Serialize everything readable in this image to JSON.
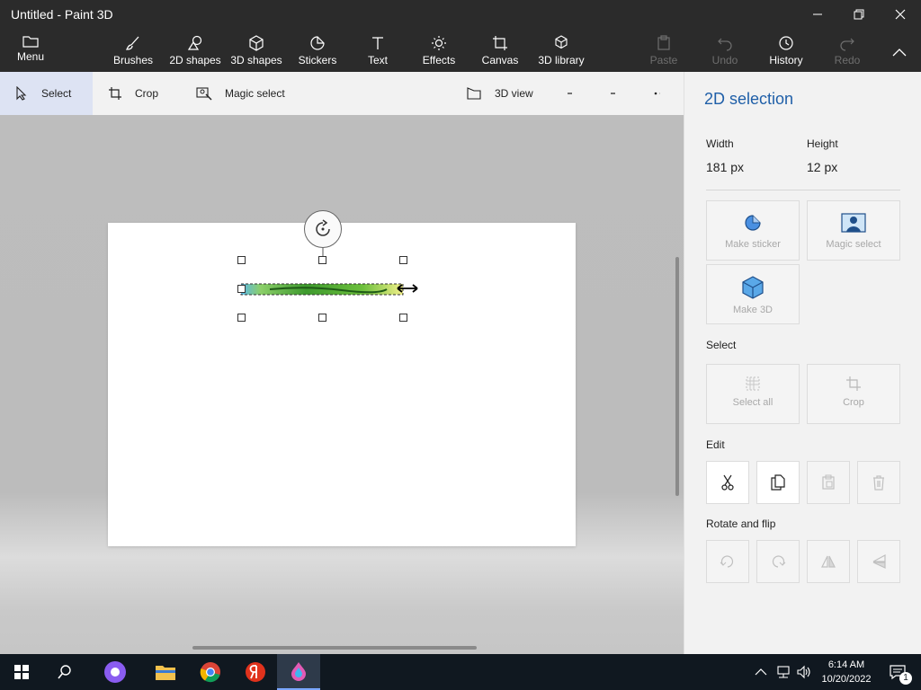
{
  "window": {
    "title": "Untitled - Paint 3D"
  },
  "ribbon": {
    "menu": "Menu",
    "brushes": "Brushes",
    "shapes2d": "2D shapes",
    "shapes3d": "3D shapes",
    "stickers": "Stickers",
    "text": "Text",
    "effects": "Effects",
    "canvas": "Canvas",
    "library3d": "3D library",
    "paste": "Paste",
    "undo": "Undo",
    "history": "History",
    "redo": "Redo"
  },
  "toolbar": {
    "select": "Select",
    "crop": "Crop",
    "magic_select": "Magic select",
    "view3d": "3D view"
  },
  "panel": {
    "title": "2D selection",
    "width_label": "Width",
    "width_value": "181 px",
    "height_label": "Height",
    "height_value": "12 px",
    "make_sticker": "Make sticker",
    "magic_select": "Magic select",
    "make_3d": "Make 3D",
    "select_section": "Select",
    "select_all": "Select all",
    "crop": "Crop",
    "edit_section": "Edit",
    "rotate_section": "Rotate and flip"
  },
  "taskbar": {
    "time": "6:14 AM",
    "date": "10/20/2022",
    "notification_count": "1"
  },
  "colors": {
    "accent": "#1f5fa8",
    "ribbon_bg": "#2b2b2b",
    "panel_bg": "#f2f2f2",
    "taskbar_bg": "#101820"
  }
}
